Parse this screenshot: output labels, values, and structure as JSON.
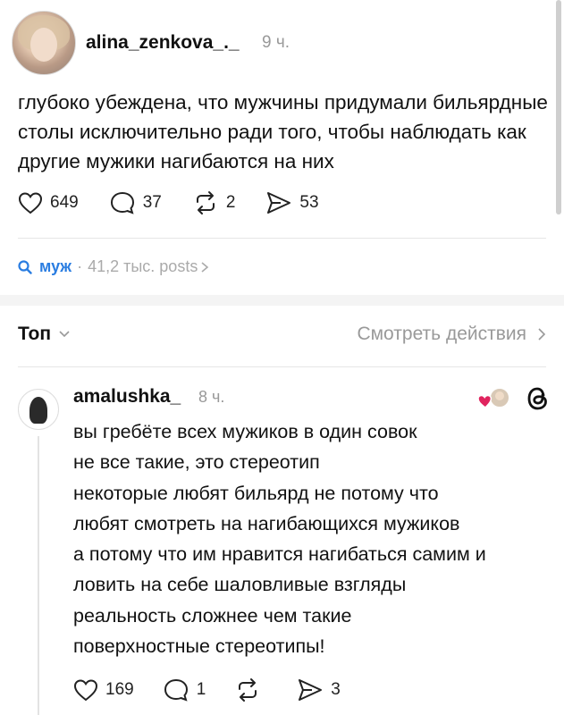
{
  "post": {
    "author": "alina_zenkova_._",
    "time": "9 ч.",
    "text": "глубоко убеждена, что мужчины придумали бильярдные столы исключительно ради того, чтобы наблюдать как другие мужики нагибаются на них",
    "likes": "649",
    "comments": "37",
    "reposts": "2",
    "shares": "53"
  },
  "search": {
    "keyword": "муж",
    "separator": "·",
    "count": "41,2 тыс. posts"
  },
  "sort": {
    "label": "Топ",
    "view_activity": "Смотреть действия"
  },
  "reply": {
    "author": "amalushka_",
    "time": "8 ч.",
    "lines": [
      "вы гребёте всех мужиков в один совок",
      "не все такие, это стереотип",
      "некоторые любят бильярд не потому что",
      "любят смотреть на нагибающихся мужиков",
      "а потому что им нравится нагибаться самим и",
      "ловить на себе шаловливые взгляды",
      "реальность сложнее чем такие",
      "поверхностные стереотипы!"
    ],
    "likes": "169",
    "comments": "1",
    "shares": "3"
  },
  "colors": {
    "accent": "#2a7de1",
    "muted": "#999999",
    "heart": "#e0245e"
  },
  "icons": [
    "heart-icon",
    "comment-icon",
    "repost-icon",
    "share-icon",
    "search-icon",
    "chevron-down-icon",
    "chevron-right-icon",
    "threads-icon"
  ]
}
